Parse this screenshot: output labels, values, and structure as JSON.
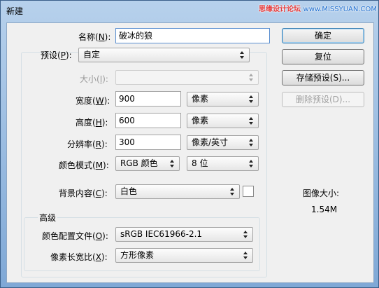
{
  "window": {
    "title": "新建"
  },
  "watermark": {
    "text": "思缘设计论坛",
    "site": "www.MISSYUAN.COM"
  },
  "form": {
    "name": {
      "label": "名称(",
      "key": "N",
      "suffix": "):",
      "value": "破冰的狼"
    },
    "preset": {
      "label": "预设(",
      "key": "P",
      "suffix": "):",
      "value": "自定"
    },
    "size": {
      "label": "大小(",
      "key": "I",
      "suffix": "):",
      "value": ""
    },
    "width": {
      "label": "宽度(",
      "key": "W",
      "suffix": "):",
      "value": "900",
      "unit": "像素"
    },
    "height": {
      "label": "高度(",
      "key": "H",
      "suffix": "):",
      "value": "600",
      "unit": "像素"
    },
    "resolution": {
      "label": "分辨率(",
      "key": "R",
      "suffix": "):",
      "value": "300",
      "unit": "像素/英寸"
    },
    "color_mode": {
      "label": "颜色模式(",
      "key": "M",
      "suffix": "):",
      "value": "RGB 颜色",
      "depth": "8 位"
    },
    "background": {
      "label": "背景内容(",
      "key": "C",
      "suffix": "):",
      "value": "白色"
    },
    "advanced": {
      "title": "高级",
      "profile": {
        "label": "颜色配置文件(",
        "key": "O",
        "suffix": "):",
        "value": "sRGB IEC61966-2.1"
      },
      "aspect": {
        "label": "像素长宽比(",
        "key": "X",
        "suffix": "):",
        "value": "方形像素"
      }
    }
  },
  "buttons": {
    "ok": "确定",
    "reset": "复位",
    "save_preset": "存储预设(S)...",
    "delete_preset": "删除预设(D)..."
  },
  "image_size": {
    "label": "图像大小:",
    "value": "1.54M"
  }
}
